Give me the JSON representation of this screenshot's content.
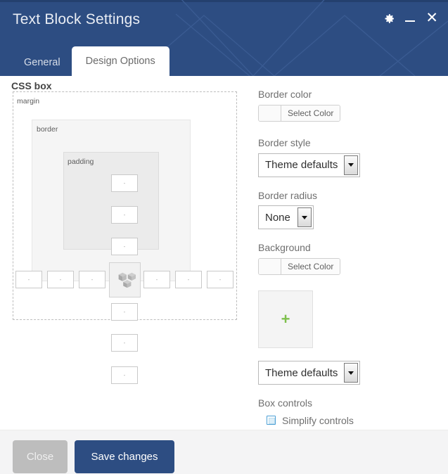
{
  "window": {
    "title": "Text Block Settings",
    "controls": {
      "settings": "gear-icon",
      "minimize": "minimize-icon",
      "close": "close-icon"
    }
  },
  "tabs": [
    {
      "label": "General",
      "active": false
    },
    {
      "label": "Design Options",
      "active": true
    }
  ],
  "css_box": {
    "section_title": "CSS box",
    "labels": {
      "margin": "margin",
      "border": "border",
      "padding": "padding"
    },
    "inputs": {
      "margin_top": "",
      "margin_right": "",
      "margin_bottom": "",
      "margin_left": "",
      "border_top": "",
      "border_right": "",
      "border_bottom": "",
      "border_left": "",
      "padding_top": "",
      "padding_right": "",
      "padding_bottom": "",
      "padding_left": "",
      "placeholder": "-"
    },
    "center_icon": "cube-icon"
  },
  "panel": {
    "border_color": {
      "label": "Border color",
      "button": "Select Color",
      "swatch": "#fafafa"
    },
    "border_style": {
      "label": "Border style",
      "value": "Theme defaults"
    },
    "border_radius": {
      "label": "Border radius",
      "value": "None"
    },
    "background": {
      "label": "Background",
      "button": "Select Color",
      "swatch": "#fafafa"
    },
    "background_image": {
      "add_icon": "plus-icon",
      "add_color": "#7ec04c"
    },
    "background_style": {
      "value": "Theme defaults"
    },
    "box_controls": {
      "label": "Box controls",
      "checkbox_label": "Simplify controls",
      "checked": false
    }
  },
  "footer": {
    "close_label": "Close",
    "save_label": "Save changes"
  },
  "colors": {
    "header_blue": "#2d4d82",
    "footer_gray": "#f4f4f5",
    "accent_green": "#7ec04c",
    "checkbox_blue": "#4b9fd5"
  }
}
